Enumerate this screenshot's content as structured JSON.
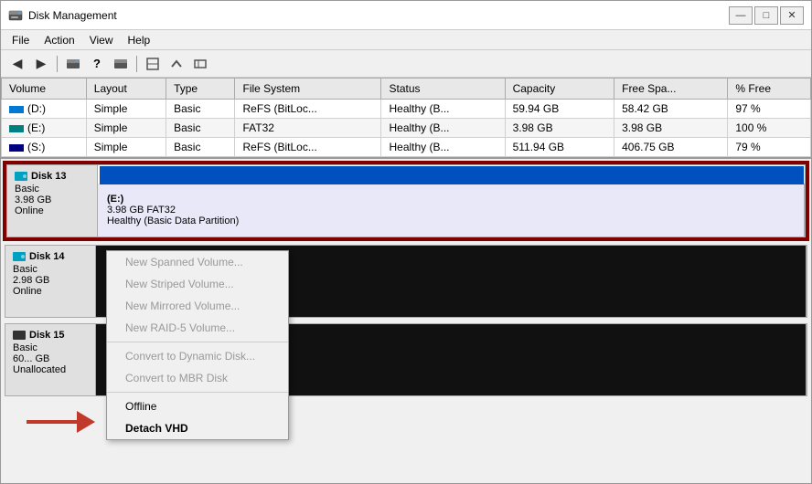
{
  "window": {
    "title": "Disk Management",
    "icon": "disk-icon"
  },
  "titlebar": {
    "controls": {
      "minimize": "—",
      "maximize": "□",
      "close": "✕"
    }
  },
  "menubar": {
    "items": [
      "File",
      "Action",
      "View",
      "Help"
    ]
  },
  "toolbar": {
    "buttons": [
      "◀",
      "▶",
      "⬛",
      "?",
      "⬛",
      "⬛",
      "⬛",
      "✓",
      "⬛"
    ]
  },
  "table": {
    "columns": [
      "Volume",
      "Layout",
      "Type",
      "File System",
      "Status",
      "Capacity",
      "Free Spa...",
      "% Free"
    ],
    "rows": [
      {
        "volume": "(D:)",
        "layout": "Simple",
        "type": "Basic",
        "fileSystem": "ReFS (BitLoc...",
        "status": "Healthy (B...",
        "capacity": "59.94 GB",
        "freeSpace": "58.42 GB",
        "percentFree": "97 %",
        "indicator": "blue"
      },
      {
        "volume": "(E:)",
        "layout": "Simple",
        "type": "Basic",
        "fileSystem": "FAT32",
        "status": "Healthy (B...",
        "capacity": "3.98 GB",
        "freeSpace": "3.98 GB",
        "percentFree": "100 %",
        "indicator": "teal"
      },
      {
        "volume": "(S:)",
        "layout": "Simple",
        "type": "Basic",
        "fileSystem": "ReFS (BitLoc...",
        "status": "Healthy (B...",
        "capacity": "511.94 GB",
        "freeSpace": "406.75 GB",
        "percentFree": "79 %",
        "indicator": "navy"
      }
    ]
  },
  "disks": [
    {
      "id": "disk13",
      "name": "Disk 13",
      "type": "Basic",
      "size": "3.98 GB",
      "status": "Online",
      "selected": true,
      "partitions": [
        {
          "name": "(E:)",
          "size": "3.98 GB FAT32",
          "status": "Healthy (Basic Data Partition)",
          "type": "data",
          "selected": true,
          "width": "100%"
        }
      ]
    },
    {
      "id": "disk14",
      "name": "Disk 14",
      "type": "Basic",
      "size": "2.98 GB",
      "status": "Online",
      "selected": false,
      "partitions": [
        {
          "name": "",
          "size": "",
          "status": "",
          "type": "unallocated",
          "selected": false,
          "width": "100%"
        }
      ]
    },
    {
      "id": "disk15",
      "name": "Disk 15",
      "type": "Basic",
      "size": "60... GB",
      "status": "Unallocated",
      "selected": false,
      "partitions": [
        {
          "name": "",
          "size": "",
          "status": "",
          "type": "unallocated",
          "selected": false,
          "width": "100%"
        }
      ]
    }
  ],
  "contextMenu": {
    "items": [
      {
        "label": "New Spanned Volume...",
        "enabled": false
      },
      {
        "label": "New Striped Volume...",
        "enabled": false
      },
      {
        "label": "New Mirrored Volume...",
        "enabled": false
      },
      {
        "label": "New RAID-5 Volume...",
        "enabled": false
      },
      {
        "separator": true
      },
      {
        "label": "Convert to Dynamic Disk...",
        "enabled": false
      },
      {
        "label": "Convert to MBR Disk",
        "enabled": false
      },
      {
        "separator": true
      },
      {
        "label": "Offline",
        "enabled": true
      },
      {
        "label": "Detach VHD",
        "enabled": true,
        "highlighted": true
      }
    ]
  },
  "arrow": {
    "color": "#c0392b"
  }
}
